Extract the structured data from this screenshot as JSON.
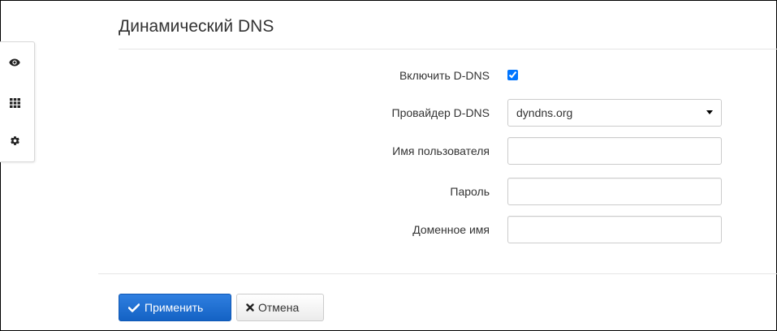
{
  "page": {
    "title": "Динамический DNS"
  },
  "sidebar": {
    "items": [
      {
        "icon": "eye-icon",
        "name": "monitoring"
      },
      {
        "icon": "grid-icon",
        "name": "applications"
      },
      {
        "icon": "gear-icon",
        "name": "settings"
      }
    ]
  },
  "form": {
    "enable": {
      "label": "Включить D-DNS",
      "checked": true
    },
    "provider": {
      "label": "Провайдер D-DNS",
      "value": "dyndns.org"
    },
    "username": {
      "label": "Имя пользователя",
      "value": ""
    },
    "password": {
      "label": "Пароль",
      "value": ""
    },
    "domain": {
      "label": "Доменное имя",
      "value": ""
    }
  },
  "footer": {
    "apply_label": "Применить",
    "cancel_label": "Отмена"
  },
  "colors": {
    "primary": "#1a6fd0",
    "text": "#333333",
    "border": "#cccccc"
  }
}
